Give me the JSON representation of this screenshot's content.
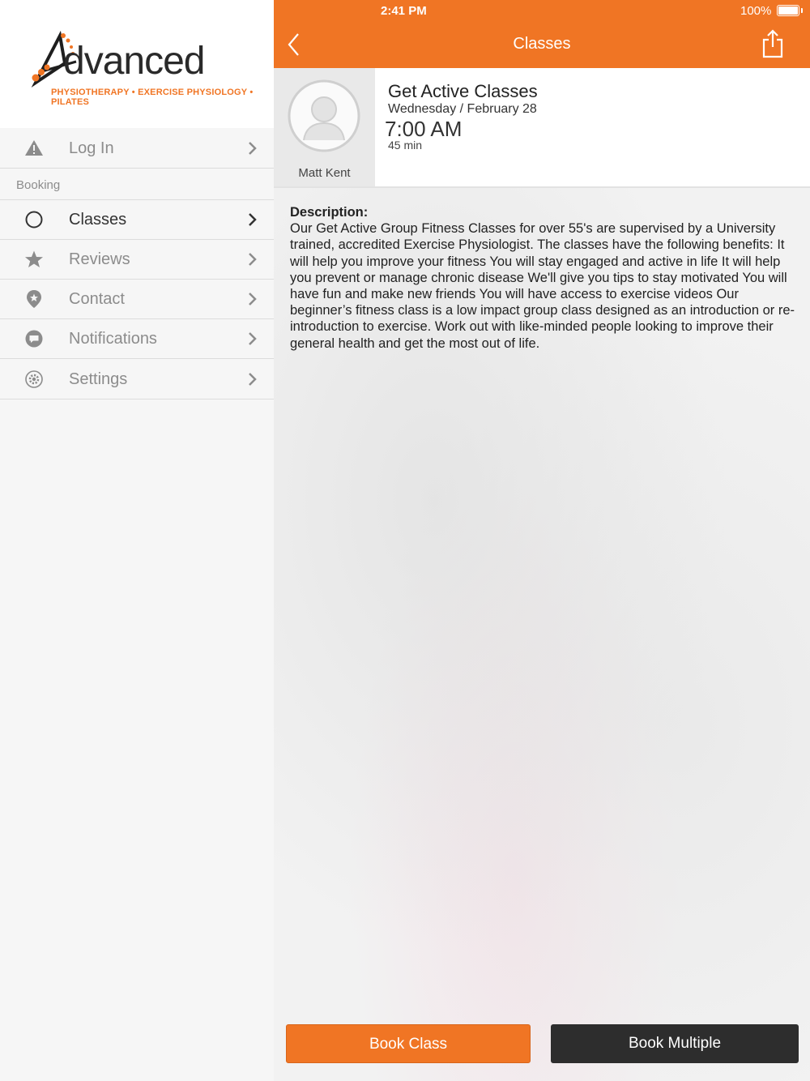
{
  "status_bar": {
    "time": "2:41 PM",
    "battery": "100%"
  },
  "brand": {
    "word": "dvanced",
    "tagline": "PHYSIOTHERAPY • EXERCISE PHYSIOLOGY • PILATES",
    "accent": "#f07524"
  },
  "sidebar": {
    "login_label": "Log In",
    "section_label": "Booking",
    "items": [
      {
        "label": "Classes",
        "icon": "circle-icon",
        "active": true
      },
      {
        "label": "Reviews",
        "icon": "star-icon",
        "active": false
      },
      {
        "label": "Contact",
        "icon": "location-pin-icon",
        "active": false
      },
      {
        "label": "Notifications",
        "icon": "chat-bubble-icon",
        "active": false
      },
      {
        "label": "Settings",
        "icon": "gear-icon",
        "active": false
      }
    ]
  },
  "header": {
    "title": "Classes"
  },
  "class": {
    "name": "Get Active Classes",
    "date": "Wednesday / February 28",
    "time": "7:00 AM",
    "duration": "45 min",
    "instructor": "Matt Kent"
  },
  "description": {
    "heading": "Description:",
    "text": "Our Get Active Group Fitness Classes for over 55's are supervised by a University trained, accredited Exercise Physiologist. The classes have the following benefits: It will help you improve your fitness You will stay engaged and active in life It will help you prevent or manage chronic disease We'll give you tips to stay motivated You will have fun and make new friends You will have access to exercise videos Our beginner’s fitness class is a low impact group class designed as an introduction or re-introduction to exercise. Work out with like-minded people looking to improve their general health and get the most out of life."
  },
  "actions": {
    "book_label": "Book Class",
    "multi_label": "Book Multiple"
  }
}
